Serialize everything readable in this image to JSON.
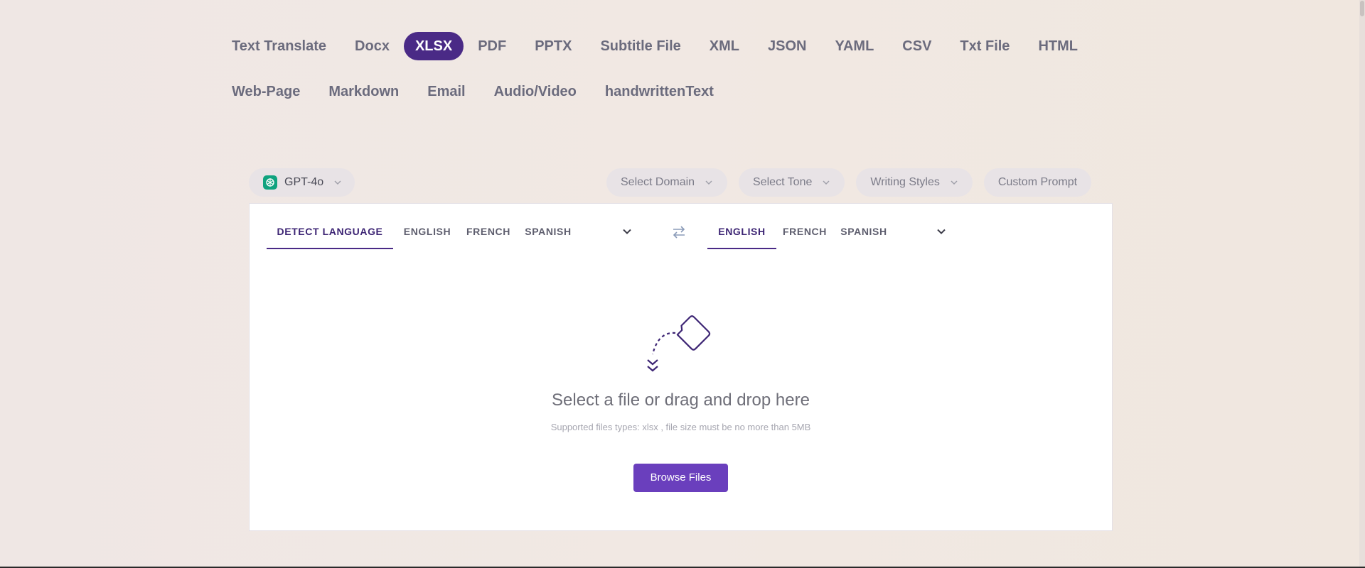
{
  "tabs": {
    "row1": [
      {
        "label": "Text Translate",
        "active": false
      },
      {
        "label": "Docx",
        "active": false
      },
      {
        "label": "XLSX",
        "active": true
      },
      {
        "label": "PDF",
        "active": false
      },
      {
        "label": "PPTX",
        "active": false
      },
      {
        "label": "Subtitle File",
        "active": false
      },
      {
        "label": "XML",
        "active": false
      },
      {
        "label": "JSON",
        "active": false
      },
      {
        "label": "YAML",
        "active": false
      },
      {
        "label": "CSV",
        "active": false
      },
      {
        "label": "Txt File",
        "active": false
      },
      {
        "label": "HTML",
        "active": false
      }
    ],
    "row2": [
      {
        "label": "Web-Page",
        "active": false
      },
      {
        "label": "Markdown",
        "active": false
      },
      {
        "label": "Email",
        "active": false
      },
      {
        "label": "Audio/Video",
        "active": false
      },
      {
        "label": "handwrittenText",
        "active": false
      }
    ]
  },
  "toolbar": {
    "model": "GPT-4o",
    "domain": "Select Domain",
    "tone": "Select Tone",
    "writing_styles": "Writing Styles",
    "custom_prompt": "Custom Prompt"
  },
  "source_langs": [
    "DETECT LANGUAGE",
    "ENGLISH",
    "FRENCH",
    "SPANISH"
  ],
  "target_langs": [
    "ENGLISH",
    "FRENCH",
    "SPANISH"
  ],
  "upload": {
    "title": "Select a file or drag and drop here",
    "subtitle": "Supported files types: xlsx , file size must be no more than 5MB",
    "button": "Browse Files"
  },
  "colors": {
    "accent": "#4a2a86",
    "button": "#6a3fbd",
    "gpt_logo": "#10a37f"
  }
}
